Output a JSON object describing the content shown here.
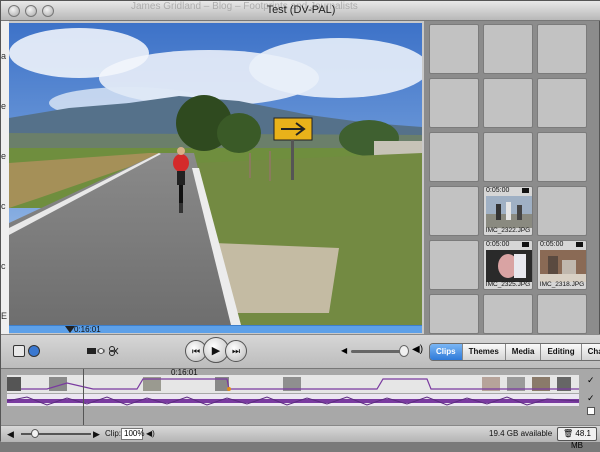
{
  "window": {
    "title": "Test (DV-PAL)",
    "ghost_title": "James Gridland – Blog – Footprints and Journalists"
  },
  "viewer": {
    "timecode": "0:16:01"
  },
  "clips": [
    {
      "duration": "0:05:00",
      "name": "IMC_2322.JPG"
    },
    {
      "duration": "0:05:00",
      "name": "IMC_2325.JPG"
    },
    {
      "duration": "0:05:00",
      "name": "IMC_2318.JPG"
    }
  ],
  "controls": {
    "playback": {
      "rewind": "⏮",
      "play": "▶",
      "forward": "⏭"
    }
  },
  "tabs": [
    "Clips",
    "Themes",
    "Media",
    "Editing",
    "Chapters"
  ],
  "active_tab": "Clips",
  "timeline": {
    "playhead_time": "0:16:01"
  },
  "bottom": {
    "clip_label": "Clip:",
    "zoom_value": "100%",
    "disk_available": "19.4 GB available",
    "trash_size": "48.1 MB"
  },
  "colors": {
    "accent": "#2f7ad9",
    "audio_wave": "#7a3aa0",
    "scrub": "#5da0e8"
  }
}
